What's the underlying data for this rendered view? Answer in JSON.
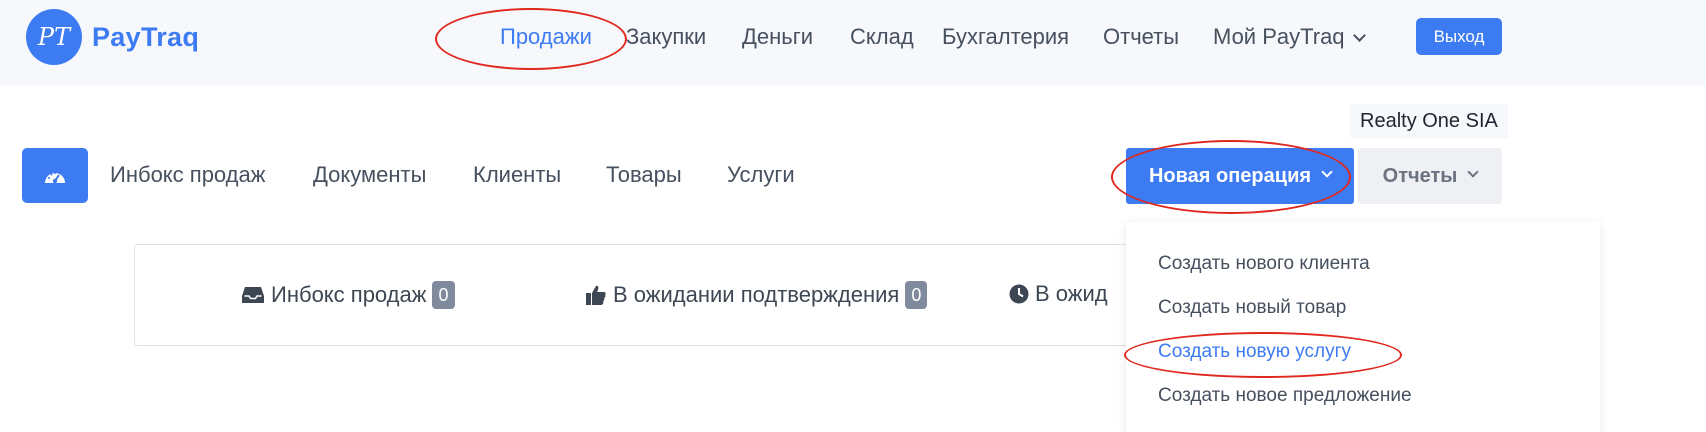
{
  "brand": {
    "logo_letters": "PT",
    "name": "PayTraq"
  },
  "main_nav": {
    "items": [
      {
        "label": "Продажи"
      },
      {
        "label": "Закупки"
      },
      {
        "label": "Деньги"
      },
      {
        "label": "Склад"
      },
      {
        "label": "Бухгалтерия"
      },
      {
        "label": "Отчеты"
      },
      {
        "label": "Мой PayTraq"
      }
    ],
    "active": "Продажи",
    "logout_label": "Выход"
  },
  "company_name": "Realty One SIA",
  "sub_nav": {
    "dashboard_icon": "speedometer-icon",
    "items": [
      {
        "label": "Инбокс продаж"
      },
      {
        "label": "Документы"
      },
      {
        "label": "Клиенты"
      },
      {
        "label": "Товары"
      },
      {
        "label": "Услуги"
      }
    ],
    "new_operation_label": "Новая операция",
    "reports_label": "Отчеты"
  },
  "status_card": {
    "items": [
      {
        "icon": "inbox-icon",
        "label": "Инбокс продаж",
        "count": "0"
      },
      {
        "icon": "thumbs-up-icon",
        "label": "В ожидании подтверждения",
        "count": "0"
      },
      {
        "icon": "clock-icon",
        "label": "В ожид",
        "count": ""
      }
    ]
  },
  "dropdown": {
    "items": [
      {
        "label": "Создать нового клиента"
      },
      {
        "label": "Создать новый товар"
      },
      {
        "label": "Создать новую услугу"
      },
      {
        "label": "Создать новое предложение"
      }
    ],
    "highlighted": "Создать новую услугу"
  },
  "colors": {
    "accent": "#3d7bf3",
    "annotation": "#e0281e",
    "badge": "#7f8a9c"
  }
}
